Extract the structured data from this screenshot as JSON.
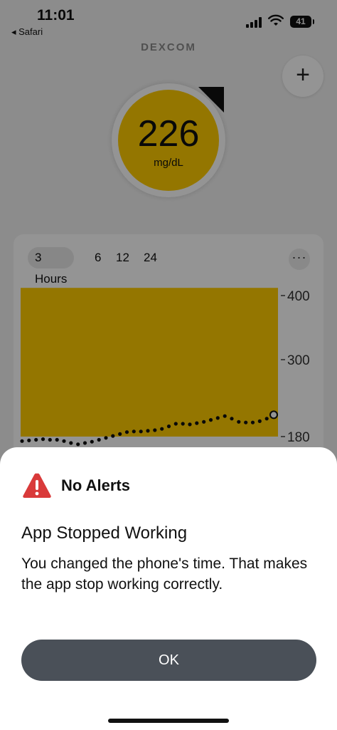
{
  "status_bar": {
    "time": "11:01",
    "back_app": "◂ Safari",
    "battery": "41"
  },
  "app": {
    "brand": "DEXCOM",
    "add_button": "+",
    "glucose": {
      "value": "226",
      "unit": "mg/dL",
      "color": "#ffcc00"
    }
  },
  "chart": {
    "tabs": [
      "3 Hours",
      "6",
      "12",
      "24"
    ],
    "active_tab": "3 Hours",
    "more_button": "···"
  },
  "chart_data": {
    "type": "scatter",
    "y_ticks": [
      "400",
      "300",
      "180"
    ],
    "ylim": [
      140,
      420
    ],
    "high_threshold": 180,
    "high_band_color": "#ffcc00",
    "series": [
      {
        "values": [
          173,
          174,
          175,
          176,
          175,
          175,
          173,
          170,
          168,
          170,
          172,
          175,
          178,
          181,
          184,
          187,
          188,
          188,
          189,
          190,
          192,
          196,
          200,
          200,
          199,
          201,
          203,
          206,
          209,
          212,
          208,
          203,
          202,
          202,
          204,
          208,
          214
        ]
      }
    ]
  },
  "alert": {
    "header": "No Alerts",
    "title": "App Stopped Working",
    "message": "You changed the phone's time. That makes the app stop working correctly.",
    "ok_label": "OK",
    "icon_color": "#d93a3a"
  }
}
